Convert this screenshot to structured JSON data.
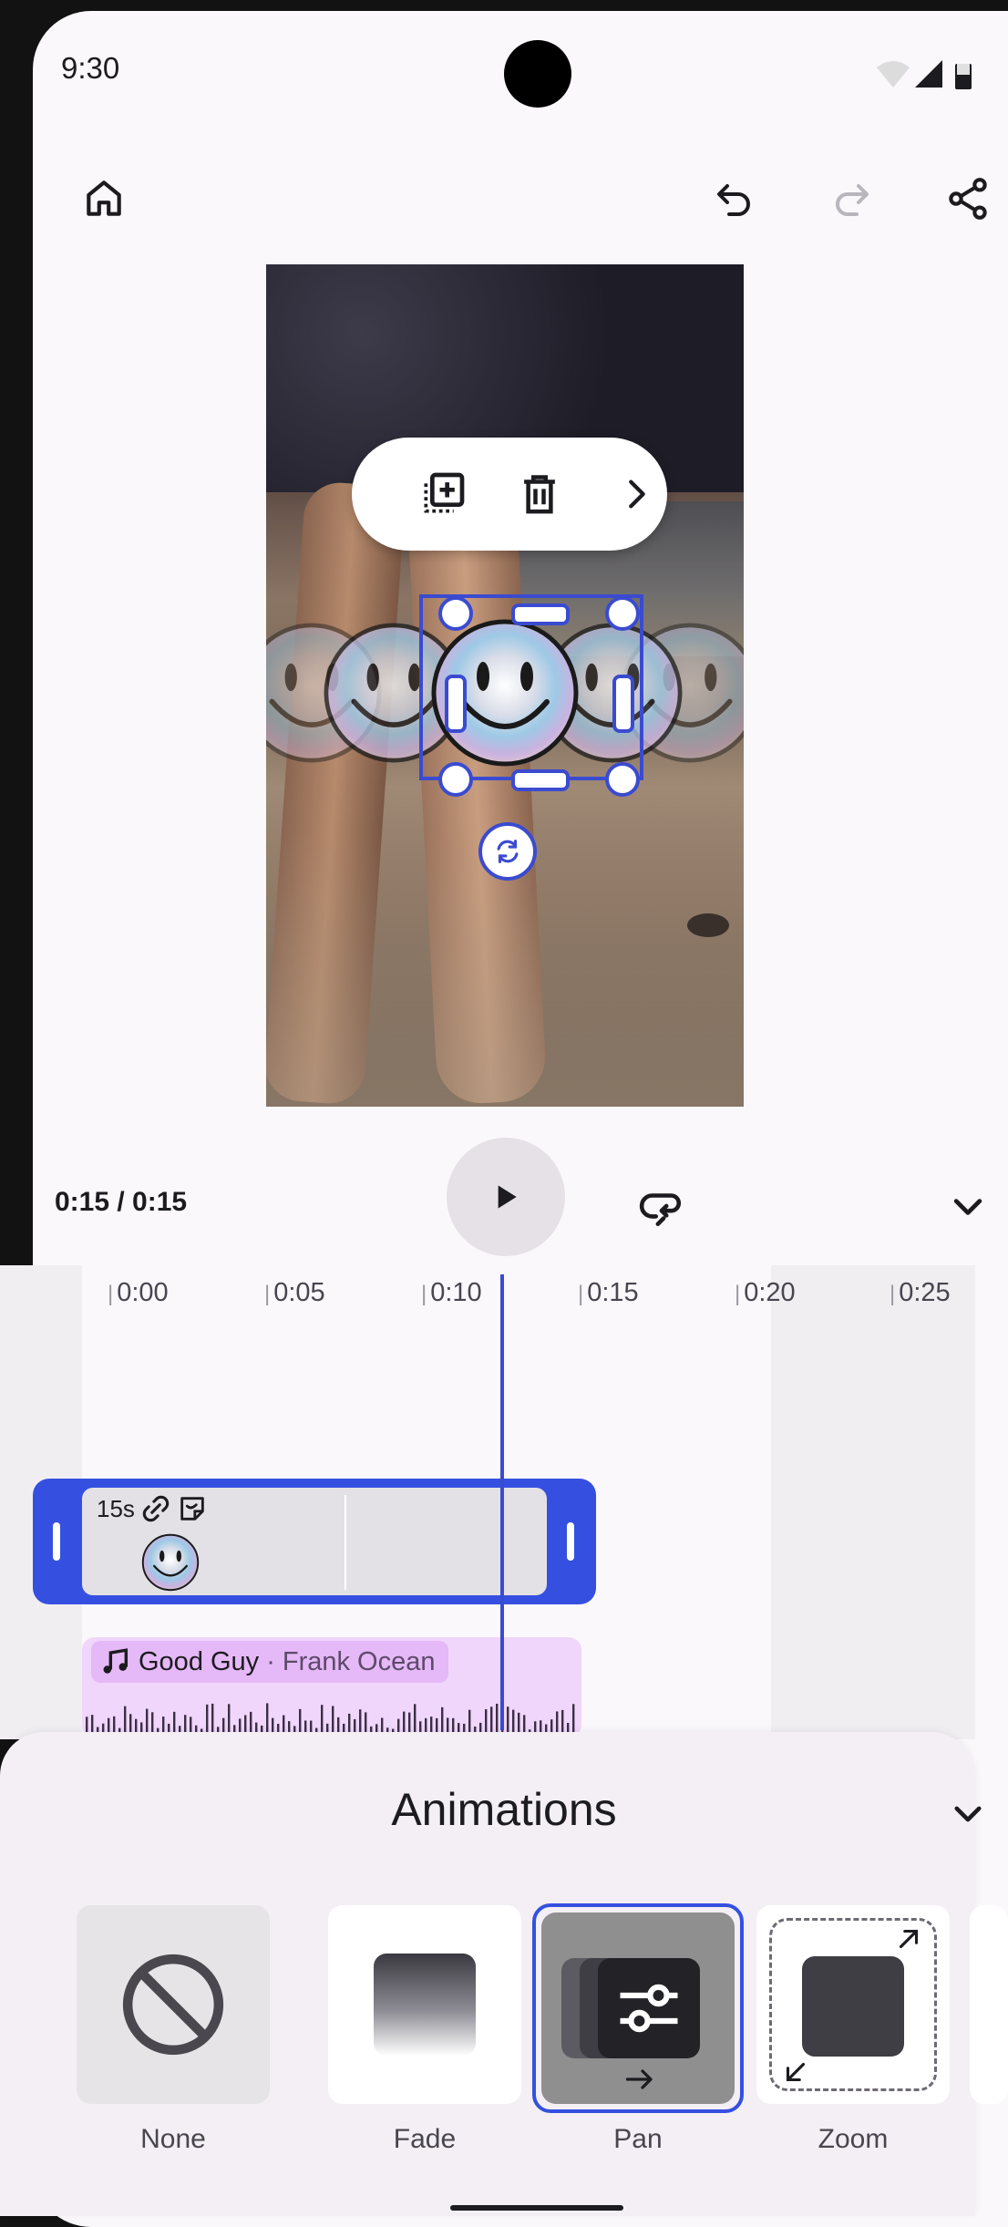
{
  "status_bar": {
    "time": "9:30"
  },
  "top_bar": {
    "home_icon": "home-icon",
    "undo_icon": "undo-icon",
    "redo_icon": "redo-icon",
    "share_icon": "share-icon"
  },
  "preview": {
    "sticker": "smiley-face-sticker",
    "context_toolbar": [
      "duplicate-icon",
      "delete-icon",
      "chevron-right-icon"
    ]
  },
  "playback": {
    "timecode": "0:15 / 0:15",
    "play_icon": "play-icon",
    "loop_icon": "loop-icon",
    "collapse_icon": "chevron-down-icon"
  },
  "timeline": {
    "ticks": [
      "0:00",
      "0:05",
      "0:10",
      "0:15",
      "0:20",
      "0:25"
    ],
    "clip": {
      "duration": "15s"
    },
    "audio": {
      "song": "Good Guy",
      "separator": " · ",
      "artist": "Frank Ocean"
    }
  },
  "animations": {
    "title": "Animations",
    "options": [
      {
        "label": "None",
        "selected": false
      },
      {
        "label": "Fade",
        "selected": false
      },
      {
        "label": "Pan",
        "selected": true
      },
      {
        "label": "Zoom",
        "selected": false
      }
    ]
  },
  "colors": {
    "accent": "#3550e0",
    "audio_track": "#f0d6fb",
    "selected_card": "#8f8f8f"
  }
}
